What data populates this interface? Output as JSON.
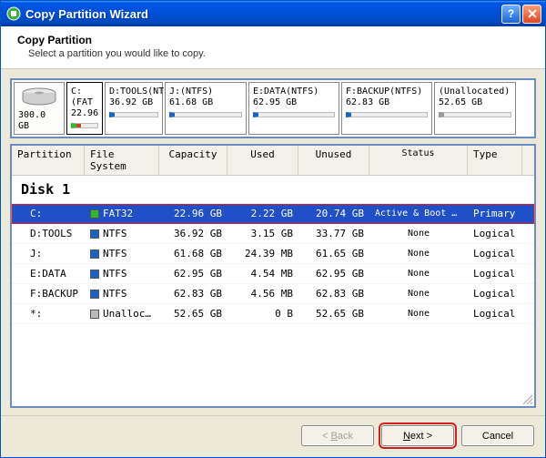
{
  "window": {
    "title": "Copy Partition Wizard"
  },
  "header": {
    "title": "Copy Partition",
    "subtitle": "Select a partition you would like to copy."
  },
  "disk": {
    "size_label": "300.0 GB"
  },
  "map": [
    {
      "name": "C:(FAT",
      "size": "22.96",
      "cls": "fat sel"
    },
    {
      "name": "D:TOOLS(NT",
      "size": "36.92 GB",
      "cls": "ntfs"
    },
    {
      "name": "J:(NTFS)",
      "size": "61.68 GB",
      "cls": "ntfs"
    },
    {
      "name": "E:DATA(NTFS)",
      "size": "62.95 GB",
      "cls": "ntfs"
    },
    {
      "name": "F:BACKUP(NTFS)",
      "size": "62.83 GB",
      "cls": "ntfs"
    },
    {
      "name": "(Unallocated)",
      "size": "52.65 GB",
      "cls": "un"
    }
  ],
  "columns": {
    "partition": "Partition",
    "fs": "File System",
    "capacity": "Capacity",
    "used": "Used",
    "unused": "Unused",
    "status": "Status",
    "type": "Type"
  },
  "group": "Disk 1",
  "rows": [
    {
      "partition": "C:",
      "fs": "FAT32",
      "fscls": "fs-fat",
      "capacity": "22.96 GB",
      "used": "2.22 GB",
      "unused": "20.74 GB",
      "status": "Active & Boot & System",
      "type": "Primary",
      "selected": true
    },
    {
      "partition": "D:TOOLS",
      "fs": "NTFS",
      "fscls": "fs-ntfs",
      "capacity": "36.92 GB",
      "used": "3.15 GB",
      "unused": "33.77 GB",
      "status": "None",
      "type": "Logical",
      "selected": false
    },
    {
      "partition": "J:",
      "fs": "NTFS",
      "fscls": "fs-ntfs",
      "capacity": "61.68 GB",
      "used": "24.39 MB",
      "unused": "61.65 GB",
      "status": "None",
      "type": "Logical",
      "selected": false
    },
    {
      "partition": "E:DATA",
      "fs": "NTFS",
      "fscls": "fs-ntfs",
      "capacity": "62.95 GB",
      "used": "4.54 MB",
      "unused": "62.95 GB",
      "status": "None",
      "type": "Logical",
      "selected": false
    },
    {
      "partition": "F:BACKUP",
      "fs": "NTFS",
      "fscls": "fs-ntfs",
      "capacity": "62.83 GB",
      "used": "4.56 MB",
      "unused": "62.83 GB",
      "status": "None",
      "type": "Logical",
      "selected": false
    },
    {
      "partition": "*:",
      "fs": "Unalloc…",
      "fscls": "fs-un",
      "capacity": "52.65 GB",
      "used": "0 B",
      "unused": "52.65 GB",
      "status": "None",
      "type": "Logical",
      "selected": false
    }
  ],
  "buttons": {
    "back": "Back",
    "next": "Next >",
    "cancel": "Cancel",
    "back_u": "B",
    "back_rest": "ack",
    "next_u": "N",
    "next_rest": "ext >",
    "back_prefix": "< "
  }
}
